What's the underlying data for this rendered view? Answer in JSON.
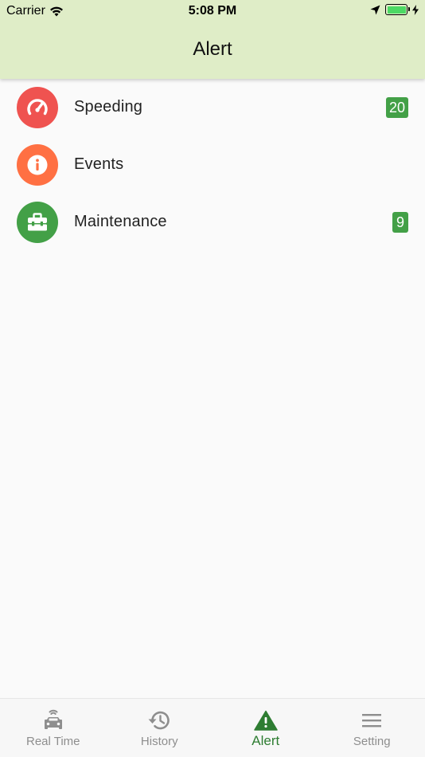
{
  "status_bar": {
    "carrier": "Carrier",
    "time": "5:08 PM",
    "battery_level": 1.0
  },
  "header": {
    "title": "Alert"
  },
  "alerts": [
    {
      "label": "Speeding",
      "count": "20",
      "icon": "speedometer-icon",
      "color": "#ef5350"
    },
    {
      "label": "Events",
      "count": "",
      "icon": "info-icon",
      "color": "#ff7043"
    },
    {
      "label": "Maintenance",
      "count": "9",
      "icon": "toolbox-icon",
      "color": "#43a047"
    }
  ],
  "tabs": [
    {
      "label": "Real Time",
      "icon": "car-icon",
      "active": false
    },
    {
      "label": "History",
      "icon": "history-icon",
      "active": false
    },
    {
      "label": "Alert",
      "icon": "warning-icon",
      "active": true
    },
    {
      "label": "Setting",
      "icon": "menu-icon",
      "active": false
    }
  ],
  "colors": {
    "header_bg": "#dfedc7",
    "badge": "#43a047",
    "active_tab": "#2e7d32",
    "inactive_tab": "#8e8e8e"
  }
}
